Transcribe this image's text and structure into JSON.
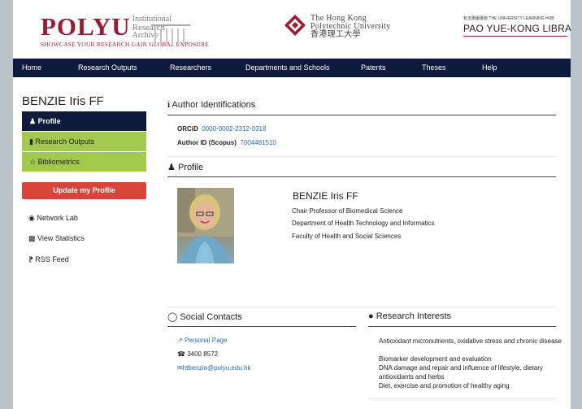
{
  "header": {
    "polyu_letters": "POLYU",
    "polyu_stack": [
      "Institutional",
      "Research",
      "Archive"
    ],
    "tagline": "SHOWCASE YOUR RESEARCH GAIN GLOBAL EXPOSURE",
    "hk_lines": [
      "The Hong Kong",
      "Polytechnic University",
      "香港理工大學"
    ],
    "library_small": "包玉剛圖書館   THE UNIVERSITY LEARNING HUB",
    "library_name": "PAO YUE-KONG LIBRARY",
    "brand_color": "#9b1b32"
  },
  "nav": {
    "items": [
      "Home",
      "Research Outputs",
      "Researchers",
      "Departments and Schools",
      "Patents",
      "Theses",
      "Help"
    ],
    "color": "#0e1a3b"
  },
  "sidebar": {
    "person_name": "BENZIE Iris FF",
    "items": [
      {
        "label": "Profile",
        "icon": "user-icon"
      },
      {
        "label": "Research Outputs",
        "icon": "book-icon"
      },
      {
        "label": "Bibliometrics",
        "icon": "star-icon"
      }
    ],
    "update_label": "Update my Profile",
    "links": [
      {
        "label": "Network Lab",
        "icon": "globe-icon"
      },
      {
        "label": "View Statistics",
        "icon": "bar-chart-icon"
      },
      {
        "label": "RSS Feed",
        "icon": "rss-icon"
      }
    ]
  },
  "author_ids": {
    "title": "Author Identifications",
    "orcid_label": "ORCiD",
    "orcid_value": "0000-0002-2312-0318",
    "scopus_label": "Author ID (Scopus)",
    "scopus_value": "7004481510"
  },
  "profile": {
    "title": "Profile",
    "name": "BENZIE Iris FF",
    "position": "Chair Professor of Biomedical Science",
    "department": "Department of Health Technology and Informatics",
    "faculty": "Faculty of Health and Social Sciences"
  },
  "social": {
    "title": "Social Contacts",
    "personal_page": "Personal Page",
    "phone": "3400 8572",
    "email": "htbenzie@polyu.edu.hk"
  },
  "interests": {
    "title": "Research Interests",
    "items": [
      "Antioxidant micronutrients, oxidative stress and chronic disease",
      "Biomarker development and evaluation",
      "DNA damage and repair and influence of lifestyle, dietary antioxidants and herbs",
      "Diet, exercise and promotion of healthy aging"
    ]
  }
}
